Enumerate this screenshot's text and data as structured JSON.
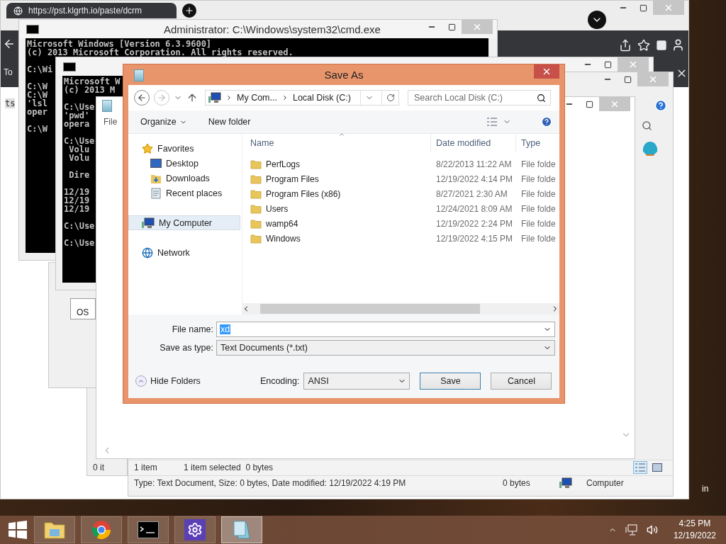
{
  "browser": {
    "tab_title": "https://pst.klgrth.io/paste/dcrm",
    "toolbar_text": "To",
    "page_text": "ts"
  },
  "consoles": [
    {
      "title": "Administrator: C:\\Windows\\system32\\cmd.exe",
      "blocks": [
        [
          "Microsoft Windows [Version 6.3.9600]",
          "(c) 2013 Microsoft Corporation. All rights reserved."
        ],
        [
          "C:\\Wi"
        ],
        [
          "C:\\W",
          "C:\\W",
          "'lsl",
          "oper"
        ],
        [
          "C:\\W"
        ]
      ]
    },
    {
      "blocks": [
        [
          "Microsoft W",
          "(c) 2013 M"
        ],
        [
          "C:\\Use",
          "'pwd'",
          "opera"
        ],
        [
          "C:\\Use",
          " Volu",
          " Volu"
        ],
        [
          " Dire"
        ],
        [
          "12/19",
          "12/19",
          "12/19"
        ],
        [
          "C:\\Use"
        ],
        [
          "C:\\Use"
        ]
      ]
    }
  ],
  "list_window": {
    "items": [
      "OS"
    ]
  },
  "back_window": {
    "status": "0 it"
  },
  "notepad_window": {
    "menu": [
      "File"
    ]
  },
  "explorer_window": {
    "status_items": [
      "1 item",
      "1 item selected  0 bytes"
    ],
    "details": "Type: Text Document, Size: 0 bytes, Date modified: 12/19/2022 4:19 PM",
    "size": "0 bytes",
    "location": "Computer"
  },
  "desktop_text": "in",
  "dialog": {
    "title": "Save As",
    "address": [
      "My Com...",
      "Local Disk (C:)"
    ],
    "search": {
      "placeholder": "Search Local Disk (C:)"
    },
    "toolbar": [
      "Organize",
      "New folder"
    ],
    "nav": [
      {
        "label": "Favorites",
        "kind": "favorites",
        "selected": false,
        "children": [
          {
            "label": "Desktop",
            "kind": "desktop",
            "selected": false
          },
          {
            "label": "Downloads",
            "kind": "downloads",
            "selected": false
          },
          {
            "label": "Recent places",
            "kind": "recent",
            "selected": false
          }
        ]
      },
      {
        "label": "My Computer",
        "kind": "computer",
        "selected": true
      },
      {
        "label": "Network",
        "kind": "network",
        "selected": false
      }
    ],
    "columns": [
      "Name",
      "Date modified",
      "Type"
    ],
    "rows": [
      {
        "name": "PerfLogs",
        "date": "8/22/2013 11:22 AM",
        "type": "File folde"
      },
      {
        "name": "Program Files",
        "date": "12/19/2022 4:14 PM",
        "type": "File folde"
      },
      {
        "name": "Program Files (x86)",
        "date": "8/27/2021 2:30 AM",
        "type": "File folde"
      },
      {
        "name": "Users",
        "date": "12/24/2021 8:09 AM",
        "type": "File folde"
      },
      {
        "name": "wamp64",
        "date": "12/19/2022 2:24 PM",
        "type": "File folde"
      },
      {
        "name": "Windows",
        "date": "12/19/2022 4:15 PM",
        "type": "File folde"
      }
    ],
    "file_name_label": "File name:",
    "file_name": {
      "value": "xd",
      "selected": true
    },
    "type_label": "Save as type:",
    "save_as_type": "Text Documents (*.txt)",
    "hide_folders": "Hide Folders",
    "encoding_label": "Encoding:",
    "encoding": "ANSI",
    "buttons": [
      "Save",
      "Cancel"
    ]
  },
  "taskbar": {
    "apps": [
      {
        "kind": "explorer",
        "selected": false
      },
      {
        "kind": "chrome",
        "selected": false
      },
      {
        "kind": "cmd",
        "selected": false
      },
      {
        "kind": "settings",
        "selected": false
      },
      {
        "kind": "notepad",
        "selected": true
      }
    ],
    "time": "4:25 PM",
    "date": "12/19/2022"
  }
}
